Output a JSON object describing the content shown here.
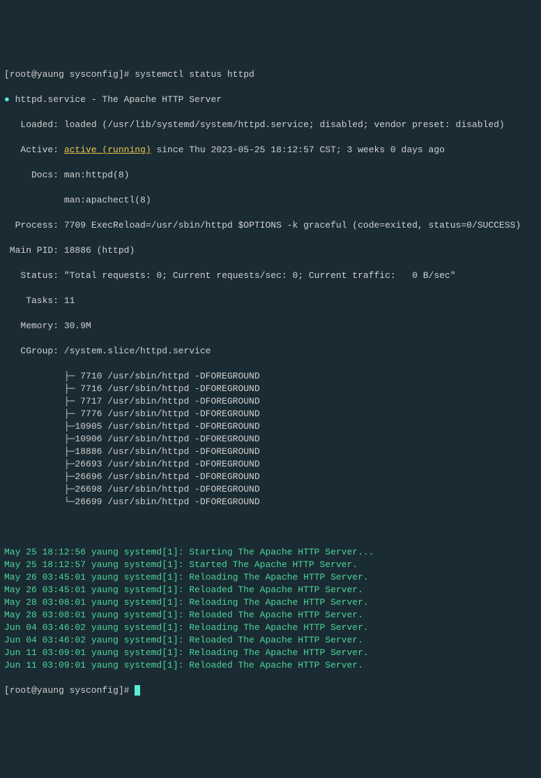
{
  "prompt1": "[root@yaung sysconfig]# ",
  "command": "systemctl status httpd",
  "dot": "●",
  "serviceName": " httpd.service - The Apache HTTP Server",
  "loadedLabel": "   Loaded: ",
  "loadedValue": "loaded (/usr/lib/systemd/system/httpd.service; disabled; vendor preset: disabled)",
  "activeLabel": "   Active: ",
  "activeStatus": "active (running)",
  "activeSince": " since Thu 2023-05-25 18:12:57 CST; 3 weeks 0 days ago",
  "docsLabel": "     Docs: ",
  "docs1": "man:httpd(8)",
  "docsPad": "           ",
  "docs2": "man:apachectl(8)",
  "processLabel": "  Process: ",
  "processValue": "7709 ExecReload=/usr/sbin/httpd $OPTIONS -k graceful (code=exited, status=0/SUCCESS)",
  "mainPidLabel": " Main PID: ",
  "mainPidValue": "18886 (httpd)",
  "statusLabel": "   Status: ",
  "statusValue": "\"Total requests: 0; Current requests/sec: 0; Current traffic:   0 B/sec\"",
  "tasksLabel": "    Tasks: ",
  "tasksValue": "11",
  "memoryLabel": "   Memory: ",
  "memoryValue": "30.9M",
  "cgroupLabel": "   CGroup: ",
  "cgroupValue": "/system.slice/httpd.service",
  "cgroupPad": "           ",
  "cgroup": [
    "├─ 7710 /usr/sbin/httpd -DFOREGROUND",
    "├─ 7716 /usr/sbin/httpd -DFOREGROUND",
    "├─ 7717 /usr/sbin/httpd -DFOREGROUND",
    "├─ 7776 /usr/sbin/httpd -DFOREGROUND",
    "├─10905 /usr/sbin/httpd -DFOREGROUND",
    "├─10906 /usr/sbin/httpd -DFOREGROUND",
    "├─18886 /usr/sbin/httpd -DFOREGROUND",
    "├─26693 /usr/sbin/httpd -DFOREGROUND",
    "├─26696 /usr/sbin/httpd -DFOREGROUND",
    "├─26698 /usr/sbin/httpd -DFOREGROUND",
    "└─26699 /usr/sbin/httpd -DFOREGROUND"
  ],
  "log": [
    "May 25 18:12:56 yaung systemd[1]: Starting The Apache HTTP Server...",
    "May 25 18:12:57 yaung systemd[1]: Started The Apache HTTP Server.",
    "May 26 03:45:01 yaung systemd[1]: Reloading The Apache HTTP Server.",
    "May 26 03:45:01 yaung systemd[1]: Reloaded The Apache HTTP Server.",
    "May 28 03:08:01 yaung systemd[1]: Reloading The Apache HTTP Server.",
    "May 28 03:08:01 yaung systemd[1]: Reloaded The Apache HTTP Server.",
    "Jun 04 03:46:02 yaung systemd[1]: Reloading The Apache HTTP Server.",
    "Jun 04 03:46:02 yaung systemd[1]: Reloaded The Apache HTTP Server.",
    "Jun 11 03:09:01 yaung systemd[1]: Reloading The Apache HTTP Server.",
    "Jun 11 03:09:01 yaung systemd[1]: Reloaded The Apache HTTP Server."
  ],
  "prompt2": "[root@yaung sysconfig]# "
}
